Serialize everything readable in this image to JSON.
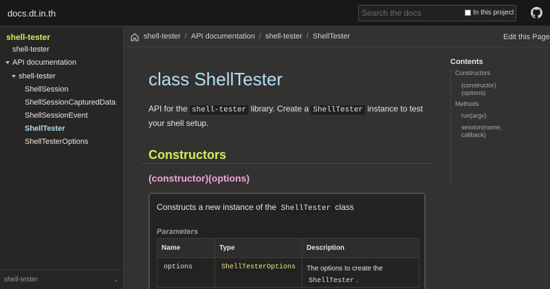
{
  "topbar": {
    "site_title": "docs.dt.in.th",
    "search_placeholder": "Search the docs",
    "in_project_label": "In this project",
    "github_icon": "github-icon"
  },
  "sidebar": {
    "project": "shell-tester",
    "items": [
      {
        "label": "shell-tester"
      },
      {
        "label": "API documentation"
      },
      {
        "label": "shell-tester"
      },
      {
        "label": "ShellSession"
      },
      {
        "label": "ShellSessionCapturedData"
      },
      {
        "label": "ShellSessionEvent"
      },
      {
        "label": "ShellTester"
      },
      {
        "label": "ShellTesterOptions"
      }
    ],
    "active": "ShellTester",
    "footer_select": "shell-tester"
  },
  "breadcrumb": {
    "items": [
      "shell-tester",
      "API documentation",
      "shell-tester",
      "ShellTester"
    ],
    "separator": "/",
    "edit_label": "Edit this Page"
  },
  "content": {
    "title": "class ShellTester",
    "intro": {
      "t1": "API for the ",
      "c1": "shell-tester",
      "t2": " library. Create a ",
      "c2": "ShellTester",
      "t3": " instance to test your shell setup."
    },
    "constructors_heading": "Constructors",
    "constructor_name": "(constructor)(options)",
    "constructor_desc": {
      "t1": "Constructs a new instance of the ",
      "c1": "ShellTester",
      "t2": " class"
    },
    "parameters_label": "Parameters",
    "table": {
      "headers": [
        "Name",
        "Type",
        "Description"
      ],
      "rows": [
        {
          "name": "options",
          "type": "ShellTesterOptions",
          "desc": "The options to create the",
          "desc_code": "ShellTester",
          "desc_end": "."
        }
      ]
    }
  },
  "toc": {
    "title": "Contents",
    "items": [
      "Constructors",
      "(constructor)",
      "(options)",
      "Methods",
      "run(argv)",
      "session(name,",
      "callback)"
    ]
  },
  "colors": {
    "title": "#b4dff7",
    "section": "#d7ec5b",
    "member": "#f4a4dc",
    "active_nav": "#b1dcf0",
    "background": "#333230"
  }
}
